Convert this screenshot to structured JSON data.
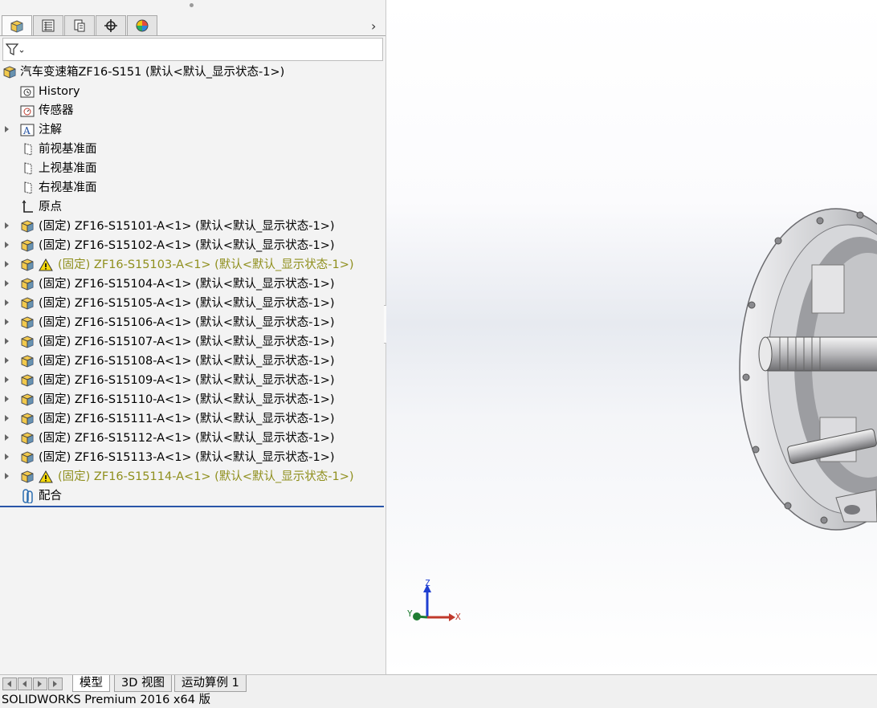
{
  "panel_tabs": [
    {
      "icon": "feature-manager-icon",
      "active": true
    },
    {
      "icon": "property-manager-icon",
      "active": false
    },
    {
      "icon": "configuration-manager-icon",
      "active": false
    },
    {
      "icon": "dimxpert-icon",
      "active": false
    },
    {
      "icon": "display-manager-icon",
      "active": false
    }
  ],
  "tree": {
    "root": "汽车变速箱ZF16-S151  (默认<默认_显示状态-1>)",
    "items": [
      {
        "label": "History",
        "icon": "history-folder-icon",
        "expander": false,
        "warning": false
      },
      {
        "label": "传感器",
        "icon": "sensor-icon",
        "expander": false,
        "warning": false
      },
      {
        "label": "注解",
        "icon": "annotation-icon",
        "expander": true,
        "warning": false
      },
      {
        "label": "前视基准面",
        "icon": "plane-icon",
        "expander": false,
        "warning": false
      },
      {
        "label": "上视基准面",
        "icon": "plane-icon",
        "expander": false,
        "warning": false
      },
      {
        "label": "右视基准面",
        "icon": "plane-icon",
        "expander": false,
        "warning": false
      },
      {
        "label": "原点",
        "icon": "origin-icon",
        "expander": false,
        "warning": false
      },
      {
        "label": "(固定) ZF16-S15101-A<1> (默认<默认_显示状态-1>)",
        "icon": "part-icon",
        "expander": true,
        "warning": false
      },
      {
        "label": "(固定) ZF16-S15102-A<1> (默认<默认_显示状态-1>)",
        "icon": "part-icon",
        "expander": true,
        "warning": false
      },
      {
        "label": "(固定) ZF16-S15103-A<1> (默认<默认_显示状态-1>)",
        "icon": "part-icon",
        "expander": true,
        "warning": true
      },
      {
        "label": "(固定) ZF16-S15104-A<1> (默认<默认_显示状态-1>)",
        "icon": "part-icon",
        "expander": true,
        "warning": false
      },
      {
        "label": "(固定) ZF16-S15105-A<1> (默认<默认_显示状态-1>)",
        "icon": "part-icon",
        "expander": true,
        "warning": false
      },
      {
        "label": "(固定) ZF16-S15106-A<1> (默认<默认_显示状态-1>)",
        "icon": "part-icon",
        "expander": true,
        "warning": false
      },
      {
        "label": "(固定) ZF16-S15107-A<1> (默认<默认_显示状态-1>)",
        "icon": "part-icon",
        "expander": true,
        "warning": false
      },
      {
        "label": "(固定) ZF16-S15108-A<1> (默认<默认_显示状态-1>)",
        "icon": "part-icon",
        "expander": true,
        "warning": false
      },
      {
        "label": "(固定) ZF16-S15109-A<1> (默认<默认_显示状态-1>)",
        "icon": "part-icon",
        "expander": true,
        "warning": false
      },
      {
        "label": "(固定) ZF16-S15110-A<1> (默认<默认_显示状态-1>)",
        "icon": "part-icon",
        "expander": true,
        "warning": false
      },
      {
        "label": "(固定) ZF16-S15111-A<1> (默认<默认_显示状态-1>)",
        "icon": "part-icon",
        "expander": true,
        "warning": false
      },
      {
        "label": "(固定) ZF16-S15112-A<1> (默认<默认_显示状态-1>)",
        "icon": "part-icon",
        "expander": true,
        "warning": false
      },
      {
        "label": "(固定) ZF16-S15113-A<1> (默认<默认_显示状态-1>)",
        "icon": "part-icon",
        "expander": true,
        "warning": false
      },
      {
        "label": "(固定) ZF16-S15114-A<1> (默认<默认_显示状态-1>)",
        "icon": "part-icon",
        "expander": true,
        "warning": true
      },
      {
        "label": "配合",
        "icon": "mates-icon",
        "expander": false,
        "warning": false
      }
    ]
  },
  "triad": {
    "x": "X",
    "y": "Y",
    "z": "Z"
  },
  "bottom_tabs": [
    "模型",
    "3D 视图",
    "运动算例 1"
  ],
  "status_bar": "SOLIDWORKS Premium 2016 x64 版",
  "colors": {
    "warning_text": "#8f8f1d",
    "selection_line": "#2a55a8"
  }
}
